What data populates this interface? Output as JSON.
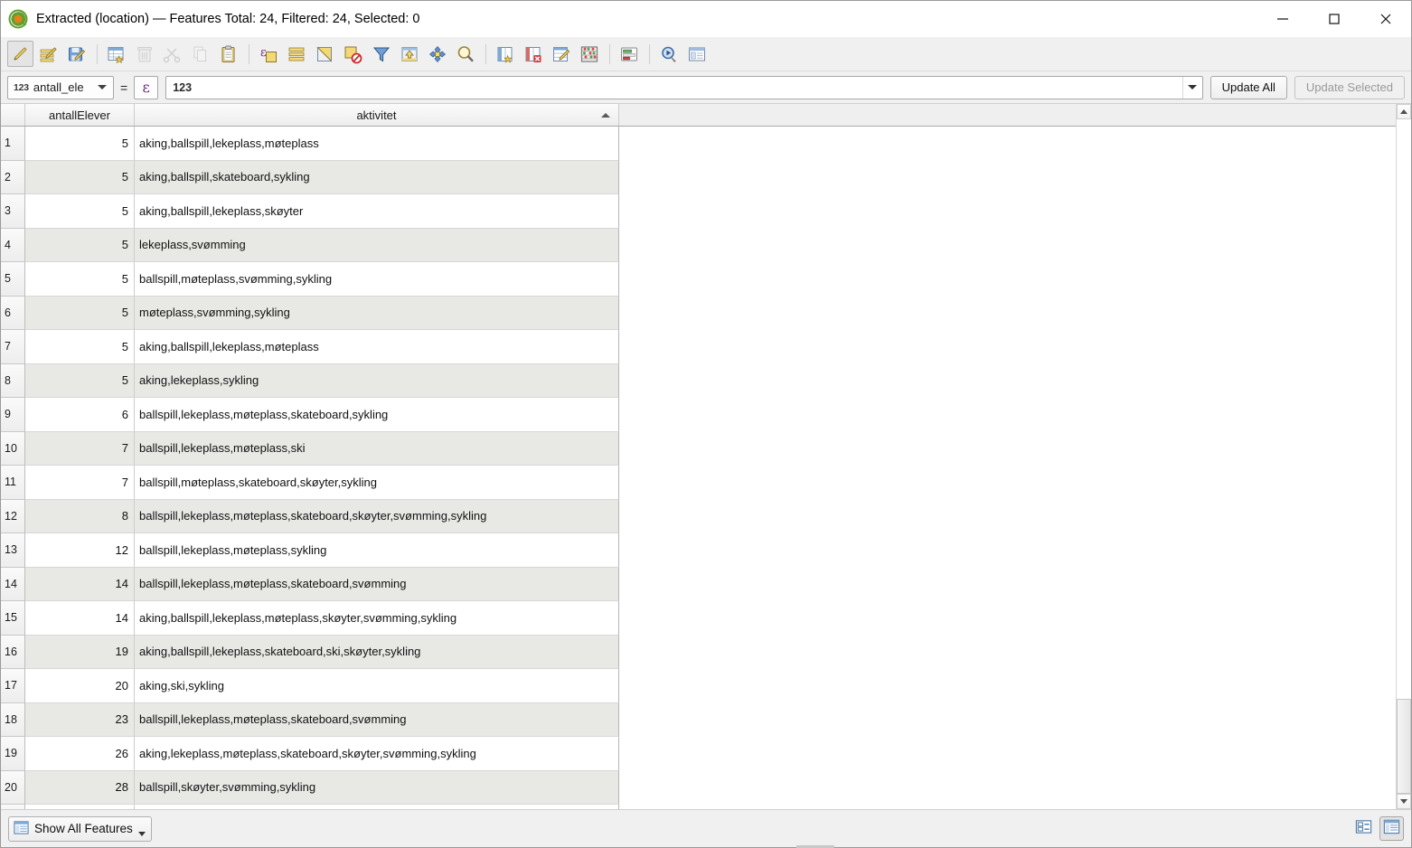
{
  "window": {
    "title": "Extracted (location) — Features Total: 24, Filtered: 24, Selected: 0",
    "app_icon": "qgis-logo-icon",
    "controls": {
      "minimize": "minimize-icon",
      "maximize": "maximize-icon",
      "close": "close-icon"
    }
  },
  "toolbar": {
    "items": [
      {
        "name": "toggle-editing-button",
        "icon": "pencil-icon",
        "enabled": true,
        "pressed": true
      },
      {
        "name": "save-edits-button",
        "icon": "multi-edit-icon",
        "enabled": true,
        "pressed": false
      },
      {
        "name": "save-layer-edits-button",
        "icon": "save-floppy-icon",
        "enabled": true,
        "pressed": false
      },
      {
        "name": "separator-1",
        "icon": "separator",
        "enabled": true,
        "pressed": false
      },
      {
        "name": "add-feature-button",
        "icon": "new-table-row-icon",
        "enabled": true,
        "pressed": false
      },
      {
        "name": "delete-selected-button",
        "icon": "trash-icon",
        "enabled": false,
        "pressed": false
      },
      {
        "name": "cut-features-button",
        "icon": "scissors-icon",
        "enabled": false,
        "pressed": false
      },
      {
        "name": "copy-features-button",
        "icon": "copy-icon",
        "enabled": false,
        "pressed": false
      },
      {
        "name": "paste-features-button",
        "icon": "clipboard-paste-icon",
        "enabled": true,
        "pressed": false
      },
      {
        "name": "separator-2",
        "icon": "separator",
        "enabled": true,
        "pressed": false
      },
      {
        "name": "select-by-expression-button",
        "icon": "epsilon-select-icon",
        "enabled": true,
        "pressed": false
      },
      {
        "name": "select-all-button",
        "icon": "select-all-rows-icon",
        "enabled": true,
        "pressed": false
      },
      {
        "name": "invert-selection-button",
        "icon": "invert-selection-icon",
        "enabled": true,
        "pressed": false
      },
      {
        "name": "deselect-all-button",
        "icon": "deselect-all-icon",
        "enabled": true,
        "pressed": false
      },
      {
        "name": "filter-select-button",
        "icon": "filter-funnel-icon",
        "enabled": true,
        "pressed": false
      },
      {
        "name": "move-selection-to-top-button",
        "icon": "move-to-top-icon",
        "enabled": true,
        "pressed": false
      },
      {
        "name": "pan-to-selected-button",
        "icon": "pan-map-icon",
        "enabled": true,
        "pressed": false
      },
      {
        "name": "zoom-to-selected-button",
        "icon": "zoom-magnifier-icon",
        "enabled": true,
        "pressed": false
      },
      {
        "name": "separator-3",
        "icon": "separator",
        "enabled": true,
        "pressed": false
      },
      {
        "name": "new-field-button",
        "icon": "new-column-icon",
        "enabled": true,
        "pressed": false
      },
      {
        "name": "delete-field-button",
        "icon": "delete-column-icon",
        "enabled": true,
        "pressed": false
      },
      {
        "name": "open-field-calculator-button",
        "icon": "field-calculator-icon",
        "enabled": true,
        "pressed": false
      },
      {
        "name": "conditional-formatting-button",
        "icon": "abacus-icon",
        "enabled": true,
        "pressed": false
      },
      {
        "name": "separator-4",
        "icon": "separator",
        "enabled": true,
        "pressed": false
      },
      {
        "name": "organize-columns-button",
        "icon": "organize-columns-icon",
        "enabled": true,
        "pressed": false
      },
      {
        "name": "separator-5",
        "icon": "separator",
        "enabled": true,
        "pressed": false
      },
      {
        "name": "actions-button",
        "icon": "action-run-icon",
        "enabled": true,
        "pressed": false
      },
      {
        "name": "dock-undock-button",
        "icon": "dock-window-icon",
        "enabled": true,
        "pressed": false
      }
    ]
  },
  "expression_bar": {
    "field_type_tag": "123",
    "field_name": "antall_ele",
    "equals": "=",
    "expression_builder_glyph": "ε",
    "expression_value": "123",
    "expression_placeholder": "",
    "update_all_label": "Update All",
    "update_selected_label": "Update Selected",
    "update_selected_enabled": false
  },
  "table": {
    "columns": [
      "antallElever",
      "aktivitet"
    ],
    "sorted_column": "aktivitet",
    "sort_direction": "ascending",
    "rows": [
      {
        "idx": "1",
        "antallElever": "5",
        "aktivitet": "aking,ballspill,lekeplass,møteplass"
      },
      {
        "idx": "2",
        "antallElever": "5",
        "aktivitet": "aking,ballspill,skateboard,sykling"
      },
      {
        "idx": "3",
        "antallElever": "5",
        "aktivitet": "aking,ballspill,lekeplass,skøyter"
      },
      {
        "idx": "4",
        "antallElever": "5",
        "aktivitet": "lekeplass,svømming"
      },
      {
        "idx": "5",
        "antallElever": "5",
        "aktivitet": "ballspill,møteplass,svømming,sykling"
      },
      {
        "idx": "6",
        "antallElever": "5",
        "aktivitet": "møteplass,svømming,sykling"
      },
      {
        "idx": "7",
        "antallElever": "5",
        "aktivitet": "aking,ballspill,lekeplass,møteplass"
      },
      {
        "idx": "8",
        "antallElever": "5",
        "aktivitet": "aking,lekeplass,sykling"
      },
      {
        "idx": "9",
        "antallElever": "6",
        "aktivitet": "ballspill,lekeplass,møteplass,skateboard,sykling"
      },
      {
        "idx": "10",
        "antallElever": "7",
        "aktivitet": "ballspill,lekeplass,møteplass,ski"
      },
      {
        "idx": "11",
        "antallElever": "7",
        "aktivitet": "ballspill,møteplass,skateboard,skøyter,sykling"
      },
      {
        "idx": "12",
        "antallElever": "8",
        "aktivitet": "ballspill,lekeplass,møteplass,skateboard,skøyter,svømming,sykling"
      },
      {
        "idx": "13",
        "antallElever": "12",
        "aktivitet": "ballspill,lekeplass,møteplass,sykling"
      },
      {
        "idx": "14",
        "antallElever": "14",
        "aktivitet": "ballspill,lekeplass,møteplass,skateboard,svømming"
      },
      {
        "idx": "15",
        "antallElever": "14",
        "aktivitet": "aking,ballspill,lekeplass,møteplass,skøyter,svømming,sykling"
      },
      {
        "idx": "16",
        "antallElever": "19",
        "aktivitet": "aking,ballspill,lekeplass,skateboard,ski,skøyter,sykling"
      },
      {
        "idx": "17",
        "antallElever": "20",
        "aktivitet": "aking,ski,sykling"
      },
      {
        "idx": "18",
        "antallElever": "23",
        "aktivitet": "ballspill,lekeplass,møteplass,skateboard,svømming"
      },
      {
        "idx": "19",
        "antallElever": "26",
        "aktivitet": "aking,lekeplass,møteplass,skateboard,skøyter,svømming,sykling"
      },
      {
        "idx": "20",
        "antallElever": "28",
        "aktivitet": "ballspill,skøyter,svømming,sykling"
      }
    ]
  },
  "scrollbar": {
    "up_arrow": "scroll-up-icon",
    "down_arrow": "scroll-down-icon"
  },
  "statusbar": {
    "show_all_features_label": "Show All Features",
    "show_all_features_icon": "table-filter-icon",
    "form_view_icon": "form-view-icon",
    "table_view_icon": "table-view-icon",
    "active_view": "table"
  },
  "colors": {
    "window_bg": "#f0f0f0",
    "row_alt": "#e8e8e4",
    "header_border": "#a9a9a9",
    "accent_yellow": "#f0d264",
    "accent_blue": "#6f9fd8",
    "qgis_green": "#5f9f2f"
  }
}
